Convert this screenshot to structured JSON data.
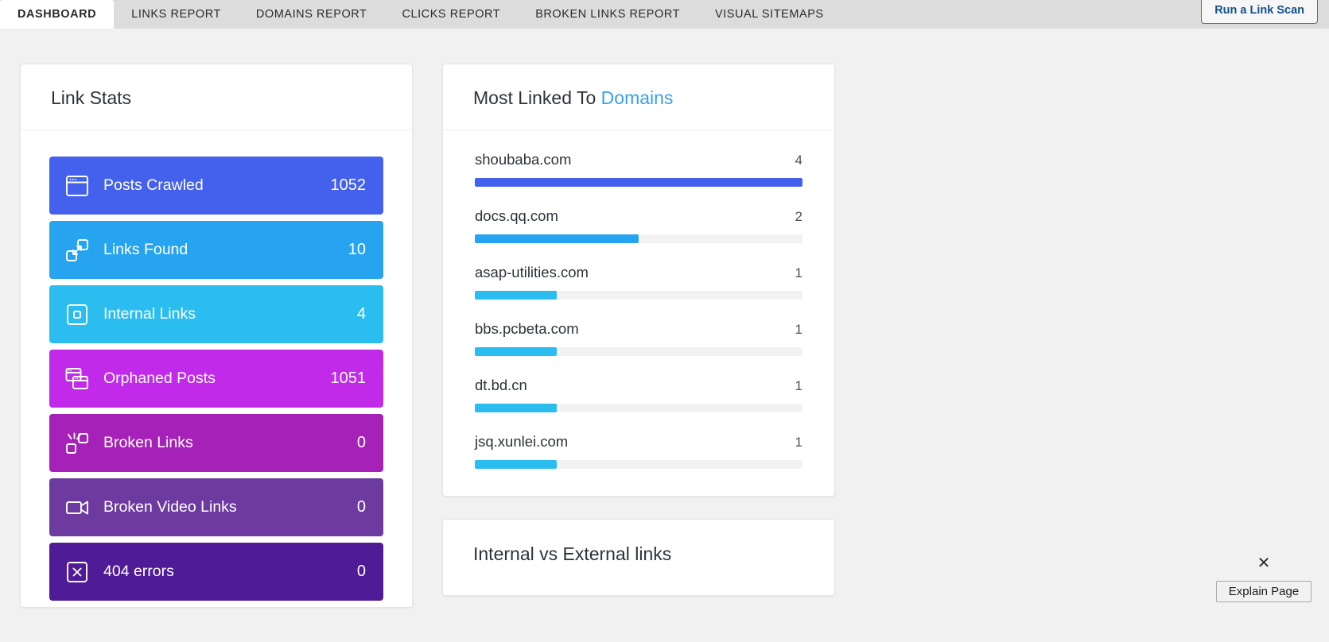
{
  "nav": {
    "tabs": [
      {
        "label": "DASHBOARD",
        "active": true
      },
      {
        "label": "LINKS REPORT",
        "active": false
      },
      {
        "label": "DOMAINS REPORT",
        "active": false
      },
      {
        "label": "CLICKS REPORT",
        "active": false
      },
      {
        "label": "BROKEN LINKS REPORT",
        "active": false
      },
      {
        "label": "VISUAL SITEMAPS",
        "active": false
      }
    ],
    "scan_button": "Run a Link Scan"
  },
  "link_stats": {
    "title": "Link Stats",
    "rows": [
      {
        "label": "Posts Crawled",
        "value": "1052",
        "color": "#4461ee",
        "icon": "browser-window-icon"
      },
      {
        "label": "Links Found",
        "value": "10",
        "color": "#27a4ef",
        "icon": "link-nodes-icon"
      },
      {
        "label": "Internal Links",
        "value": "4",
        "color": "#2bbdf0",
        "icon": "square-inside-icon"
      },
      {
        "label": "Orphaned Posts",
        "value": "1051",
        "color": "#c02ae8",
        "icon": "stacked-windows-icon"
      },
      {
        "label": "Broken Links",
        "value": "0",
        "color": "#a521b8",
        "icon": "broken-link-icon"
      },
      {
        "label": "Broken Video Links",
        "value": "0",
        "color": "#6d3ba0",
        "icon": "video-camera-icon"
      },
      {
        "label": "404 errors",
        "value": "0",
        "color": "#4f1b96",
        "icon": "x-square-icon"
      }
    ]
  },
  "most_linked": {
    "title_main": "Most Linked To",
    "title_accent": "Domains",
    "rows": [
      {
        "domain": "shoubaba.com",
        "count": "4",
        "percent": 100,
        "color": "#4461ee"
      },
      {
        "domain": "docs.qq.com",
        "count": "2",
        "percent": 50,
        "color": "#27a4ef"
      },
      {
        "domain": "asap-utilities.com",
        "count": "1",
        "percent": 25,
        "color": "#2bbdf0"
      },
      {
        "domain": "bbs.pcbeta.com",
        "count": "1",
        "percent": 25,
        "color": "#2bbdf0"
      },
      {
        "domain": "dt.bd.cn",
        "count": "1",
        "percent": 25,
        "color": "#2bbdf0"
      },
      {
        "domain": "jsq.xunlei.com",
        "count": "1",
        "percent": 25,
        "color": "#2bbdf0"
      }
    ]
  },
  "internal_vs_external": {
    "title": "Internal vs External links"
  },
  "explain_widget": {
    "close_label": "✕",
    "button_label": "Explain Page"
  }
}
